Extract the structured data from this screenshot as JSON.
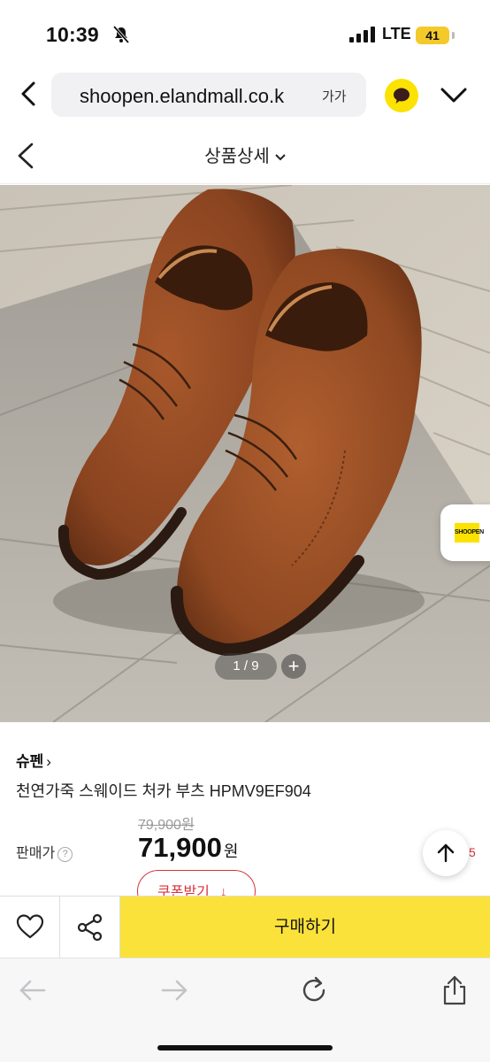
{
  "status_bar": {
    "time": "10:39",
    "network": "LTE",
    "battery": "41"
  },
  "browser": {
    "url": "shoopen.elandmall.co.k",
    "text_size_label": "가가"
  },
  "page_header": {
    "title": "상품상세"
  },
  "gallery": {
    "pager": "1 / 9",
    "plus": "+",
    "badge_logo": "SHOOPEN"
  },
  "product": {
    "brand": "슈펜",
    "brand_arrow": "›",
    "name": "천연가죽 스웨이드 처카 부츠 HPMV9EF904",
    "original_price": "79,900원",
    "price_label": "판매가",
    "help_icon_text": "?",
    "price": "71,900",
    "currency": "원",
    "coupon_label": "쿠폰받기",
    "coupon_arrow": "↓",
    "side_fragment": "5"
  },
  "action_bar": {
    "buy_label": "구매하기"
  },
  "colors": {
    "accent_yellow": "#fbe23a",
    "kakao_yellow": "#fbe200",
    "coupon_red": "#d8333a"
  }
}
